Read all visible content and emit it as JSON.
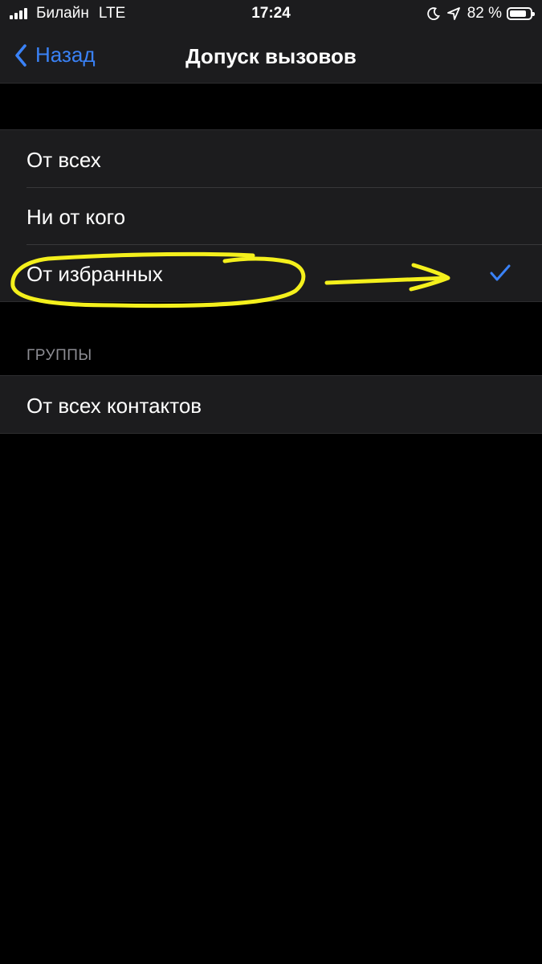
{
  "status_bar": {
    "carrier": "Билайн",
    "network": "LTE",
    "time": "17:24",
    "battery_percent": "82 %",
    "battery_level": 0.82,
    "icons": [
      "signal-icon",
      "moon-icon",
      "location-arrow-icon",
      "battery-icon"
    ]
  },
  "nav": {
    "back_label": "Назад",
    "title": "Допуск вызовов"
  },
  "options": [
    {
      "label": "От всех",
      "selected": false
    },
    {
      "label": "Ни от кого",
      "selected": false
    },
    {
      "label": "От избранных",
      "selected": true
    }
  ],
  "groups": {
    "header": "ГРУППЫ",
    "items": [
      {
        "label": "От всех контактов"
      }
    ]
  },
  "colors": {
    "accent": "#3a82f7",
    "background": "#000000",
    "cell_background": "#1c1c1e",
    "secondary_text": "#8d8d93",
    "annotation": "#f4f01c"
  }
}
